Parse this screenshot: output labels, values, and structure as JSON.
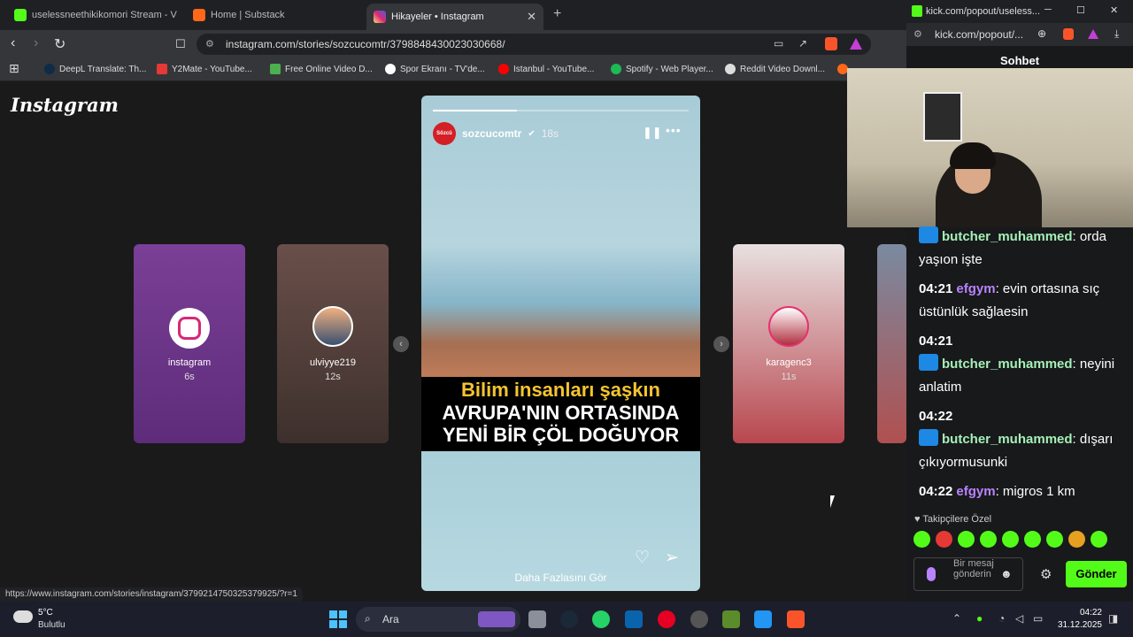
{
  "tabs": [
    {
      "title": "uselessneethikikomori Stream - V",
      "favicon_color": "#53fc18",
      "active": false
    },
    {
      "title": "Home | Substack",
      "favicon_color": "#ff6719",
      "active": false
    },
    {
      "title": "Hikayeler • Instagram",
      "favicon_color": "#dd2a7b",
      "active": true
    }
  ],
  "url": "instagram.com/stories/sozcucomtr/3798848430023030668/",
  "bookmarks": [
    {
      "label": "DeepL Translate: Th...",
      "color": "#0f2b46"
    },
    {
      "label": "Y2Mate - YouTube...",
      "color": "#e53935"
    },
    {
      "label": "Free Online Video D...",
      "color": "#4caf50"
    },
    {
      "label": "Spor Ekranı - TV'de...",
      "color": "#ffffff"
    },
    {
      "label": "Istanbul - YouTube...",
      "color": "#ff0000"
    },
    {
      "label": "Spotify - Web Player...",
      "color": "#1db954"
    },
    {
      "label": "Reddit Video Downl...",
      "color": "#dddddd"
    }
  ],
  "instagram": {
    "logo": "Instagram",
    "side_stories": [
      {
        "user": "instagram",
        "time": "6s"
      },
      {
        "user": "ulviyye219",
        "time": "12s"
      },
      {
        "user": "karagenc3",
        "time": "11s"
      }
    ],
    "story": {
      "user": "sozcucomtr",
      "time": "18s",
      "avatar_text": "Sözcü",
      "progress": 0.33,
      "headline_1": "Bilim insanları şaşkın",
      "headline_2": "AVRUPA'NIN ORTASINDA",
      "headline_3": "YENİ BİR ÇÖL DOĞUYOR",
      "see_more": "Daha Fazlasını Gör"
    },
    "status_url": "https://www.instagram.com/stories/instagram/3799214750325379925/?r=1"
  },
  "kick": {
    "window_title": "kick.com/popout/useless...",
    "address": "kick.com/popout/...",
    "header": "Sohbet",
    "messages": [
      {
        "time": "",
        "user": "butcher_muhammed",
        "text": "orda yaşıon işte",
        "color": "green",
        "badge": true
      },
      {
        "time": "04:21",
        "user": "efgym",
        "text": "evin ortasına sıç üstünlük sağlaesin",
        "color": "purple",
        "badge": false
      },
      {
        "time": "04:21",
        "user": "butcher_muhammed",
        "text": "neyini anlatim",
        "color": "green",
        "badge": true
      },
      {
        "time": "04:22",
        "user": "butcher_muhammed",
        "text": "dışarı çıkıyormusunki",
        "color": "green",
        "badge": true
      },
      {
        "time": "04:22",
        "user": "efgym",
        "text": "migros 1 km",
        "color": "purple",
        "badge": false
      }
    ],
    "followers_only": "Takipçilere Özel",
    "input_placeholder": "Bir mesaj gönderin",
    "send_label": "Gönder"
  },
  "taskbar": {
    "temperature": "5°C",
    "weather": "Bulutlu",
    "search_label": "Ara",
    "time": "04:22",
    "date": "31.12.2025"
  }
}
